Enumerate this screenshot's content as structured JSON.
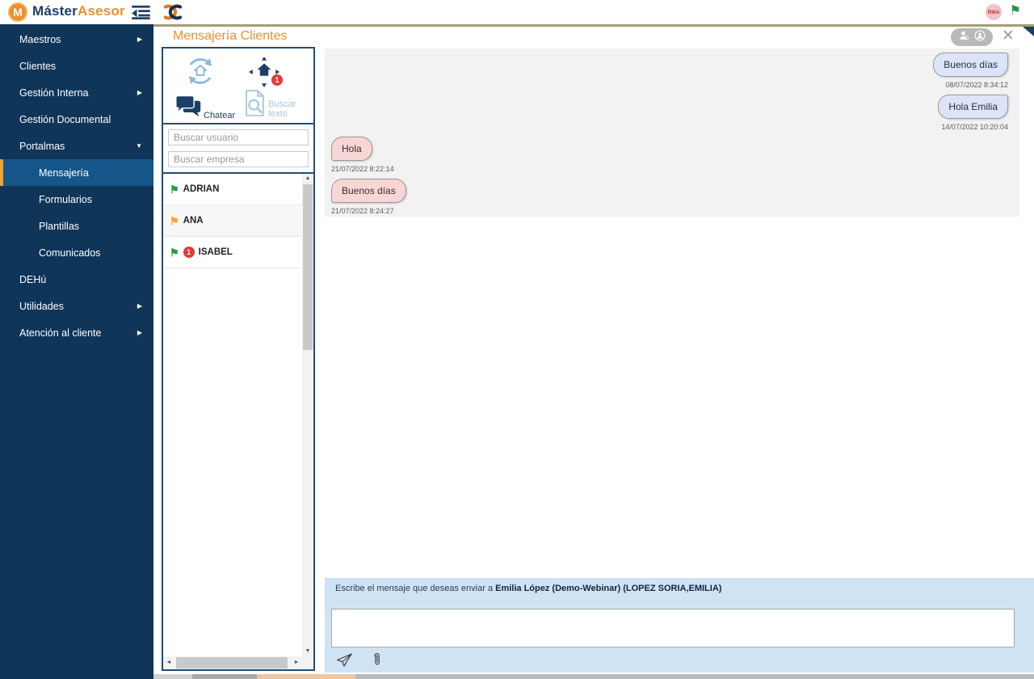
{
  "app": {
    "brand_primary": "Máster",
    "brand_secondary": "Asesor",
    "brand_monogram": "M",
    "avatar_initials": "RMA"
  },
  "sidebar": {
    "items": [
      {
        "label": "Maestros",
        "arrow": "right"
      },
      {
        "label": "Clientes",
        "arrow": "none"
      },
      {
        "label": "Gestión Interna",
        "arrow": "right"
      },
      {
        "label": "Gestión Documental",
        "arrow": "none"
      },
      {
        "label": "Portalmas",
        "arrow": "down"
      },
      {
        "label": "Mensajería",
        "selected": true
      },
      {
        "label": "Formularios"
      },
      {
        "label": "Plantillas"
      },
      {
        "label": "Comunicados"
      },
      {
        "label": "DEHú"
      },
      {
        "label": "Utilidades",
        "arrow": "right"
      },
      {
        "label": "Atención al cliente",
        "arrow": "right"
      }
    ]
  },
  "panel": {
    "title": "Mensajería Clientes",
    "tools": {
      "chat_label": "Chatear",
      "search_text_label": "Buscar texto",
      "home_badge": "1"
    },
    "filters": {
      "user_placeholder": "Buscar usuario",
      "company_placeholder": "Buscar empresa"
    },
    "contacts": [
      {
        "name": "ADRIAN",
        "flag": "green"
      },
      {
        "name": "ANA",
        "flag": "orange"
      },
      {
        "name": "ISABEL",
        "flag": "green",
        "badge": "1"
      }
    ]
  },
  "chat": {
    "messages": [
      {
        "side": "right",
        "text": "Buenos días",
        "time": "08/07/2022 8:34:12"
      },
      {
        "side": "right",
        "text": "Hola Emilia",
        "time": "14/07/2022 10:20:04"
      },
      {
        "side": "left",
        "text": "Hola",
        "time": "21/07/2022 8:22:14"
      },
      {
        "side": "left",
        "text": "Buenos días",
        "time": "21/07/2022 8:24:27"
      }
    ],
    "compose": {
      "label_prefix": "Escribe el mensaje que deseas enviar a ",
      "recipient": "Emilia López (Demo-Webinar) (LOPEZ SORIA,EMILIA)"
    }
  },
  "colors": {
    "accent_orange": "#e8912d",
    "sidebar_navy": "#0f3558",
    "selected_blue": "#15568a",
    "selected_bar_orange": "#f0a030",
    "tan_divider": "#a79d72",
    "bubble_right_blue": "#dde4f7",
    "bubble_left_pink": "#f9d6d6",
    "compose_blue": "#cfe3f5",
    "badge_red": "#e53935",
    "flag_green": "#1e9e3e",
    "flag_orange": "#f5a623",
    "icon_light_blue": "#a8c6de",
    "icon_navy": "#1c3f67"
  }
}
